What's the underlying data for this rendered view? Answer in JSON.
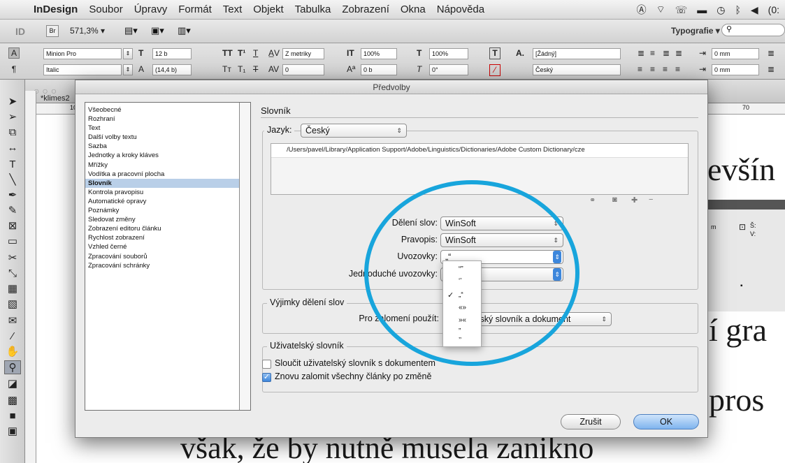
{
  "menubar": {
    "app_name": "InDesign",
    "items": [
      "Soubor",
      "Úpravy",
      "Formát",
      "Text",
      "Objekt",
      "Tabulka",
      "Zobrazení",
      "Okna",
      "Nápověda"
    ],
    "tray_text": "(0:"
  },
  "appbar": {
    "logo": "ID",
    "bridge": "Br",
    "zoom": "571,3% ▾",
    "workspace": "Typografie ▾"
  },
  "control_panel": {
    "font_family": "Minion Pro",
    "font_style": "Italic",
    "font_size": "12 b",
    "leading": "(14,4 b)",
    "kerning": "Z metriky",
    "tracking": "0",
    "vscale": "100%",
    "hscale": "100%",
    "baseline": "0 b",
    "skew": "0°",
    "char_style": "[Žádný]",
    "language": "Český",
    "indent1": "0 mm",
    "indent2": "0 mm"
  },
  "document": {
    "tab_title": "*klimes2",
    "ruler_marks": [
      "10",
      "70"
    ],
    "text_line1": "evšín",
    "text_line2": "í gra",
    "text_line3": "pros",
    "text_line4": "však, že by nutně musela zanikno"
  },
  "side_panel": {
    "label_s": "Š:",
    "label_v": "V:",
    "label_m": "m"
  },
  "dialog": {
    "title": "Předvolby",
    "categories": [
      "Všeobecné",
      "Rozhraní",
      "Text",
      "Další volby textu",
      "Sazba",
      "Jednotky a kroky kláves",
      "Mřížky",
      "Vodítka a pracovní plocha",
      "Slovník",
      "Kontrola pravopisu",
      "Automatické opravy",
      "Poznámky",
      "Sledovat změny",
      "Zobrazení editoru článku",
      "Rychlost zobrazení",
      "Vzhled černé",
      "Zpracování souborů",
      "Zpracování schránky"
    ],
    "selected_category": "Slovník",
    "section_title": "Slovník",
    "language_label": "Jazyk:",
    "language_value": "Český",
    "dictionary_path": "/Users/pavel/Library/Application Support/Adobe/Linguistics/Dictionaries/Adobe Custom Dictionary/cze",
    "hyphenation_label": "Dělení slov:",
    "hyphenation_value": "WinSoft",
    "spelling_label": "Pravopis:",
    "spelling_value": "WinSoft",
    "quotes_label": "Uvozovky:",
    "quotes_value": "„“",
    "single_quotes_label": "Jednoduché uvozovky:",
    "single_quotes_value": "",
    "exceptions_group": "Výjimky dělení slov",
    "compose_label": "Pro zalomení použít:",
    "compose_value": "Uživatelský slovník a dokument",
    "user_dict_group": "Uživatelský slovník",
    "merge_label": "Sloučit uživatelský slovník s dokumentem",
    "merge_checked": false,
    "recompose_label": "Znovu zalomit všechny články po změně",
    "recompose_checked": true,
    "cancel": "Zrušit",
    "ok": "OK"
  },
  "quotes_popup": {
    "items": [
      "“”",
      "‘’",
      "„“",
      "«»",
      "»«",
      "”",
      "’’"
    ],
    "checked_index": 2
  },
  "highlight_color": "#18a5dc"
}
